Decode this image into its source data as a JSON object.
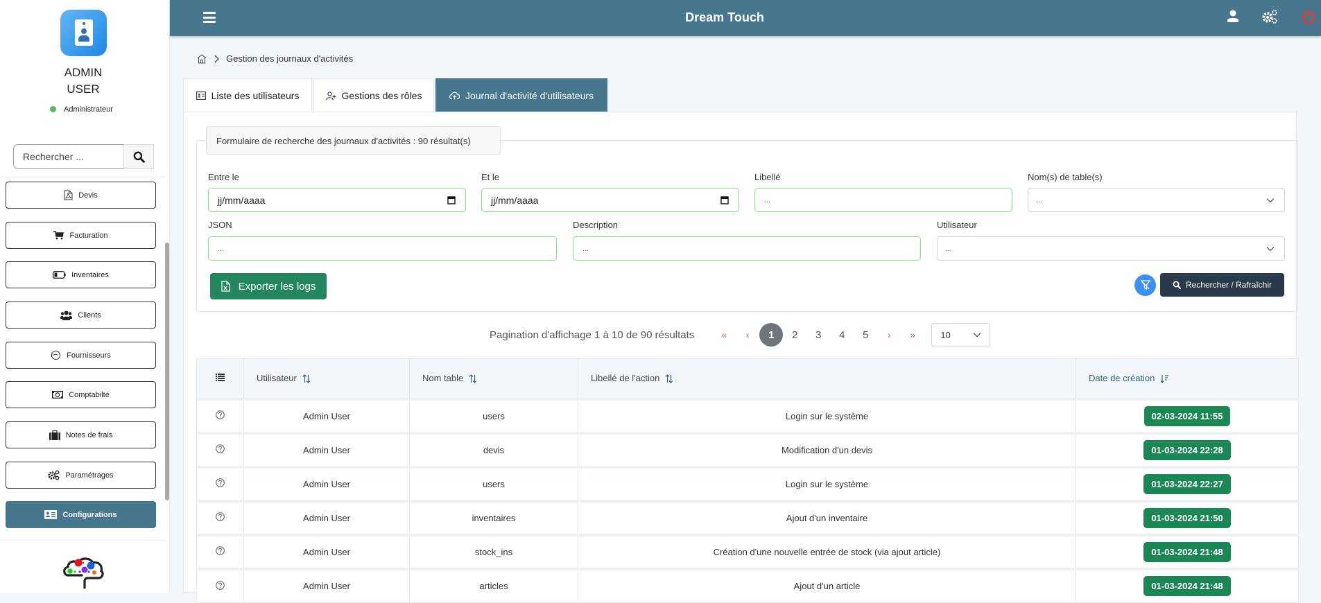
{
  "app": {
    "title": "Dream Touch"
  },
  "user": {
    "name_line1": "ADMIN",
    "name_line2": "USER",
    "role": "Administrateur",
    "status_color": "#5cb85c"
  },
  "sidebar": {
    "search_placeholder": "Rechercher ...",
    "items": [
      {
        "label": "Devis",
        "icon": "file-pdf-icon"
      },
      {
        "label": "Facturation",
        "icon": "cart-icon"
      },
      {
        "label": "Inventaires",
        "icon": "battery-icon"
      },
      {
        "label": "Clients",
        "icon": "users-icon"
      },
      {
        "label": "Fournisseurs",
        "icon": "supplier-icon"
      },
      {
        "label": "Comptabilté",
        "icon": "money-icon"
      },
      {
        "label": "Notes de frais",
        "icon": "suitcase-icon"
      },
      {
        "label": "Paramétrages",
        "icon": "gears-icon"
      },
      {
        "label": "Configurations",
        "icon": "id-card-icon",
        "active": true
      }
    ]
  },
  "header": {
    "icons": [
      "user-icon",
      "settings-icon",
      "power-icon"
    ],
    "accent": "#46778f",
    "power_color": "#e53935"
  },
  "breadcrumb": {
    "current": "Gestion des journaux d'activités"
  },
  "tabs": [
    {
      "label": "Liste des utilisateurs"
    },
    {
      "label": "Gestions des rôles"
    },
    {
      "label": "Journal d'activité d'utilisateurs",
      "active": true
    }
  ],
  "search_form": {
    "legend": "Formulaire de recherche des journaux d'activités : 90 résultat(s)",
    "fields": {
      "start_date": {
        "label": "Entre le",
        "value": "jj/mm/aaaa"
      },
      "end_date": {
        "label": "Et le",
        "value": "jj/mm/aaaa"
      },
      "libelle": {
        "label": "Libellé",
        "placeholder": "..."
      },
      "tables": {
        "label": "Nom(s) de table(s)",
        "value": "..."
      },
      "json": {
        "label": "JSON",
        "placeholder": "..."
      },
      "description": {
        "label": "Description",
        "placeholder": "..."
      },
      "utilisateur": {
        "label": "Utilisateur",
        "value": "..."
      }
    },
    "export_label": "Exporter les logs",
    "refresh_label": "Rechercher / Rafraîchir"
  },
  "pagination": {
    "info": "Pagination d'affichage 1 à 10 de 90 résultats",
    "first": "«",
    "prev": "‹",
    "pages": [
      "1",
      "2",
      "3",
      "4",
      "5"
    ],
    "current_page": "1",
    "next": "›",
    "last": "»",
    "page_size": "10"
  },
  "table": {
    "columns": [
      "Utilisateur",
      "Nom table",
      "Libellé de l'action",
      "Date de création"
    ],
    "rows": [
      {
        "user": "Admin User",
        "table": "users",
        "action": "Login sur le système",
        "date": "02-03-2024 11:55"
      },
      {
        "user": "Admin User",
        "table": "devis",
        "action": "Modification d'un devis",
        "date": "01-03-2024 22:28"
      },
      {
        "user": "Admin User",
        "table": "users",
        "action": "Login sur le système",
        "date": "01-03-2024 22:27"
      },
      {
        "user": "Admin User",
        "table": "inventaires",
        "action": "Ajout d'un inventaire",
        "date": "01-03-2024 21:50"
      },
      {
        "user": "Admin User",
        "table": "stock_ins",
        "action": "Création d'une nouvelle entrée de stock (via ajout article)",
        "date": "01-03-2024 21:48"
      },
      {
        "user": "Admin User",
        "table": "articles",
        "action": "Ajout d'un article",
        "date": "01-03-2024 21:48"
      }
    ]
  }
}
